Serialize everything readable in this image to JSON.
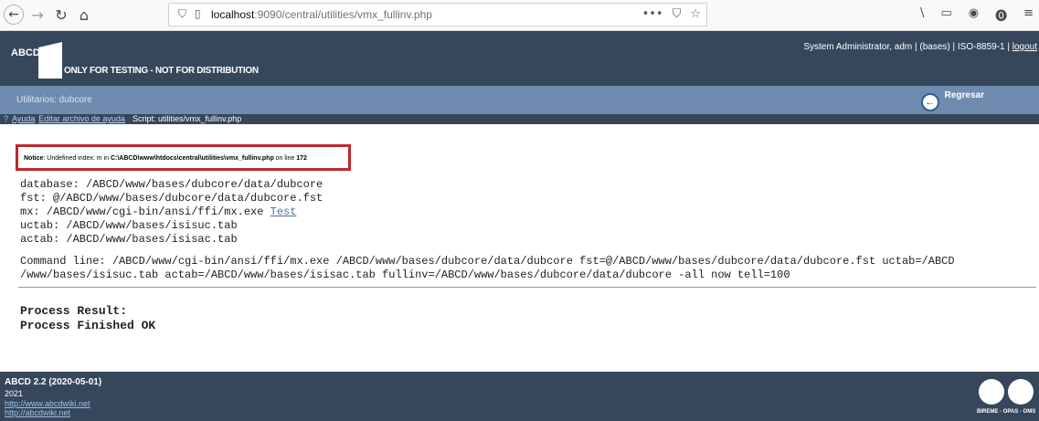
{
  "browser": {
    "back_icon": "←",
    "forward_icon": "→",
    "reload_icon": "↻",
    "home_icon": "⌂",
    "url_host": "localhost",
    "url_path": ":9090/central/utilities/vmx_fullinv.php",
    "url_actions": [
      "•••",
      "⛉",
      "☆"
    ],
    "toolbar_icons": [
      "\\",
      "▭",
      "◉",
      "⓿",
      "≡"
    ]
  },
  "header": {
    "logo_text": "ABCD",
    "notice": "ONLY FOR TESTING - NOT FOR DISTRIBUTION",
    "user_info": "System Administrator, adm | (bases) | ISO-8859-1 | ",
    "logout_label": "logout"
  },
  "section": {
    "title": "Utilitarios: dubcore",
    "back_label": "Regresar",
    "back_icon": "←"
  },
  "help_bar": {
    "help_icon": "?",
    "help_label": "Ayuda",
    "edit_label": "Editar archivo de ayuda",
    "script_label": "Script: utilities/vmx_fullinv.php"
  },
  "notice": {
    "prefix": "Notice",
    "message": ": Undefined index: m in ",
    "file": "C:\\ABCD\\www\\htdocs\\central\\utilities\\vmx_fullinv.php",
    "line_text": " on line ",
    "line": "172"
  },
  "info": {
    "database": "database: /ABCD/www/bases/dubcore/data/dubcore",
    "fst": "fst: @/ABCD/www/bases/dubcore/data/dubcore.fst",
    "mx": "mx: /ABCD/www/cgi-bin/ansi/ffi/mx.exe ",
    "test_link": "Test",
    "uctab": "uctab: /ABCD/www/bases/isisuc.tab",
    "actab": "actab: /ABCD/www/bases/isisac.tab"
  },
  "command": {
    "line1": "Command line: /ABCD/www/cgi-bin/ansi/ffi/mx.exe /ABCD/www/bases/dubcore/data/dubcore fst=@/ABCD/www/bases/dubcore/data/dubcore.fst uctab=/ABCD",
    "line2": "/www/bases/isisuc.tab actab=/ABCD/www/bases/isisac.tab fullinv=/ABCD/www/bases/dubcore/data/dubcore -all now tell=100"
  },
  "result": {
    "title": "Process Result:",
    "status": "Process Finished OK"
  },
  "footer": {
    "version": "ABCD 2.2  (2020-05-01)",
    "year": "2021",
    "link1": "http://www.abcdwiki.net",
    "link2": "http://abcdwiki.net",
    "logo_text": "BIREME · OPAS · OMS"
  }
}
